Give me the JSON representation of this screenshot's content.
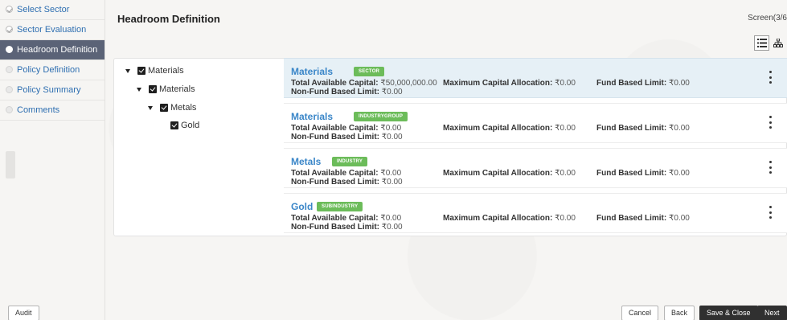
{
  "steps": [
    {
      "label": "Select Sector",
      "state": "done"
    },
    {
      "label": "Sector Evaluation",
      "state": "done"
    },
    {
      "label": "Headroom Definition",
      "state": "active"
    },
    {
      "label": "Policy Definition",
      "state": "pending"
    },
    {
      "label": "Policy Summary",
      "state": "pending"
    },
    {
      "label": "Comments",
      "state": "pending"
    }
  ],
  "header": {
    "title": "Headroom Definition",
    "screen": "Screen(3/6"
  },
  "tree": [
    {
      "label": "Materials",
      "checked": true,
      "expanded": true
    },
    {
      "label": "Materials",
      "checked": true,
      "expanded": true
    },
    {
      "label": "Metals",
      "checked": true,
      "expanded": true
    },
    {
      "label": "Gold",
      "checked": true,
      "expanded": false
    }
  ],
  "labels": {
    "total_capital": "Total Available Capital:",
    "non_fund_limit": "Non-Fund Based Limit:",
    "max_allocation": "Maximum Capital Allocation:",
    "fund_limit": "Fund Based Limit:"
  },
  "entities": [
    {
      "name": "Materials",
      "tag": "SECTOR",
      "total_capital": "₹50,000,000.00",
      "non_fund_limit": "₹0.00",
      "max_allocation": "₹0.00",
      "fund_limit": "₹0.00"
    },
    {
      "name": "Materials",
      "tag": "INDUSTRYGROUP",
      "total_capital": "₹0.00",
      "non_fund_limit": "₹0.00",
      "max_allocation": "₹0.00",
      "fund_limit": "₹0.00"
    },
    {
      "name": "Metals",
      "tag": "INDUSTRY",
      "total_capital": "₹0.00",
      "non_fund_limit": "₹0.00",
      "max_allocation": "₹0.00",
      "fund_limit": "₹0.00"
    },
    {
      "name": "Gold",
      "tag": "SUBINDUSTRY",
      "total_capital": "₹0.00",
      "non_fund_limit": "₹0.00",
      "max_allocation": "₹0.00",
      "fund_limit": "₹0.00"
    }
  ],
  "footer": {
    "audit": "Audit",
    "cancel": "Cancel",
    "back": "Back",
    "save_close": "Save & Close",
    "next": "Next"
  },
  "colors": {
    "active_step_bg": "#5b6377",
    "link_blue": "#3a86c8",
    "tag_green": "#6cbc5a",
    "selected_row_bg": "#e6f0f6"
  }
}
